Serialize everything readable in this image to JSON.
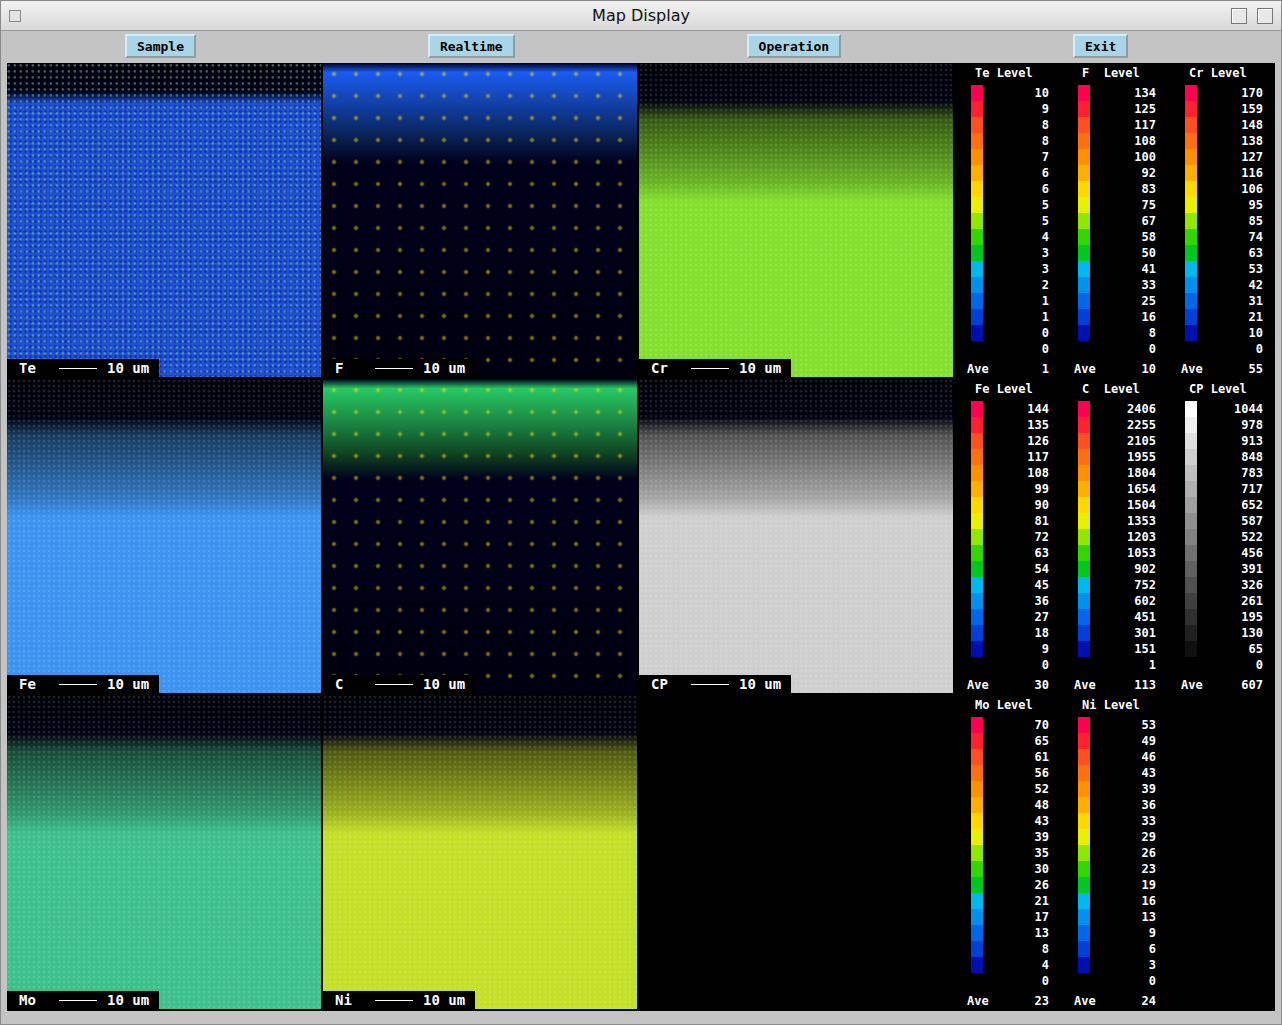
{
  "window": {
    "title": "Map Display"
  },
  "toolbar": {
    "buttons": [
      "Sample",
      "Realtime",
      "Operation",
      "Exit"
    ]
  },
  "rows": [
    {
      "maps": [
        {
          "label": "Te",
          "scale": "10 um",
          "kind": "uniform",
          "color": "#1f4fd8"
        },
        {
          "label": "F",
          "scale": "10 um",
          "kind": "surface",
          "color": "#1a5cf0"
        },
        {
          "label": "Cr",
          "scale": "10 um",
          "kind": "bulk",
          "color": "#84e02c"
        }
      ],
      "legends": [
        {
          "title": "Te Level",
          "kind": "color",
          "values": [
            "10",
            "9",
            "8",
            "8",
            "7",
            "6",
            "6",
            "5",
            "5",
            "4",
            "3",
            "3",
            "2",
            "1",
            "1",
            "0",
            "0"
          ],
          "ave_label": "Ave",
          "ave": "1"
        },
        {
          "title": "F  Level",
          "kind": "color",
          "values": [
            "134",
            "125",
            "117",
            "108",
            "100",
            "92",
            "83",
            "75",
            "67",
            "58",
            "50",
            "41",
            "33",
            "25",
            "16",
            "8",
            "0"
          ],
          "ave_label": "Ave",
          "ave": "10"
        },
        {
          "title": "Cr Level",
          "kind": "color",
          "values": [
            "170",
            "159",
            "148",
            "138",
            "127",
            "116",
            "106",
            "95",
            "85",
            "74",
            "63",
            "53",
            "42",
            "31",
            "21",
            "10",
            "0"
          ],
          "ave_label": "Ave",
          "ave": "55"
        }
      ]
    },
    {
      "maps": [
        {
          "label": "Fe",
          "scale": "10 um",
          "kind": "bulk",
          "color": "#3c94f0"
        },
        {
          "label": "C",
          "scale": "10 um",
          "kind": "surface",
          "color": "#28c864"
        },
        {
          "label": "CP",
          "scale": "10 um",
          "kind": "bulk",
          "color": "#cfcfcf"
        }
      ],
      "legends": [
        {
          "title": "Fe Level",
          "kind": "color",
          "values": [
            "144",
            "135",
            "126",
            "117",
            "108",
            "99",
            "90",
            "81",
            "72",
            "63",
            "54",
            "45",
            "36",
            "27",
            "18",
            "9",
            "0"
          ],
          "ave_label": "Ave",
          "ave": "30"
        },
        {
          "title": "C  Level",
          "kind": "color",
          "values": [
            "2406",
            "2255",
            "2105",
            "1955",
            "1804",
            "1654",
            "1504",
            "1353",
            "1203",
            "1053",
            "902",
            "752",
            "602",
            "451",
            "301",
            "151",
            "1"
          ],
          "ave_label": "Ave",
          "ave": "113"
        },
        {
          "title": "CP Level",
          "kind": "gray",
          "values": [
            "1044",
            "978",
            "913",
            "848",
            "783",
            "717",
            "652",
            "587",
            "522",
            "456",
            "391",
            "326",
            "261",
            "195",
            "130",
            "65",
            "0"
          ],
          "ave_label": "Ave",
          "ave": "607"
        }
      ]
    },
    {
      "maps": [
        {
          "label": "Mo",
          "scale": "10 um",
          "kind": "bulk",
          "color": "#3cc08c"
        },
        {
          "label": "Ni",
          "scale": "10 um",
          "kind": "bulk",
          "color": "#c4e028"
        }
      ],
      "legends": [
        {
          "title": "Mo Level",
          "kind": "color",
          "values": [
            "70",
            "65",
            "61",
            "56",
            "52",
            "48",
            "43",
            "39",
            "35",
            "30",
            "26",
            "21",
            "17",
            "13",
            "8",
            "4",
            "0"
          ],
          "ave_label": "Ave",
          "ave": "23"
        },
        {
          "title": "Ni Level",
          "kind": "color",
          "values": [
            "53",
            "49",
            "46",
            "43",
            "39",
            "36",
            "33",
            "29",
            "26",
            "23",
            "19",
            "16",
            "13",
            "9",
            "6",
            "3",
            "0"
          ],
          "ave_label": "Ave",
          "ave": "24"
        }
      ]
    }
  ]
}
